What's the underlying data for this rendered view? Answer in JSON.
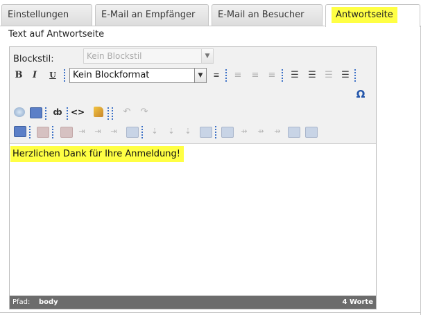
{
  "tabs": [
    {
      "label": "Einstellungen",
      "active": false
    },
    {
      "label": "E-Mail an Empfänger",
      "active": false
    },
    {
      "label": "E-Mail an Besucher",
      "active": false
    },
    {
      "label": "Antwortseite",
      "active": true
    }
  ],
  "panel": {
    "label": "Text auf Antwortseite"
  },
  "editor": {
    "blockstil_label": "Blockstil:",
    "blockstil_value": "Kein Blockstil",
    "format_value": "Kein Blockformat",
    "content_text": "Herzlichen Dank für Ihre Anmeldung!",
    "path_label": "Pfad:",
    "path_value": "body",
    "word_count": "4 Worte",
    "toolbar_row1": [
      "bold",
      "italic",
      "underline"
    ],
    "icons": {
      "bold": "B",
      "italic": "I",
      "underline": "U",
      "omega": "Ω",
      "code": "<>",
      "binoculars": "🔍"
    }
  },
  "colors": {
    "highlight": "#ffff44",
    "statusbar": "#6c6c6c",
    "separator": "#3a6fc6"
  }
}
